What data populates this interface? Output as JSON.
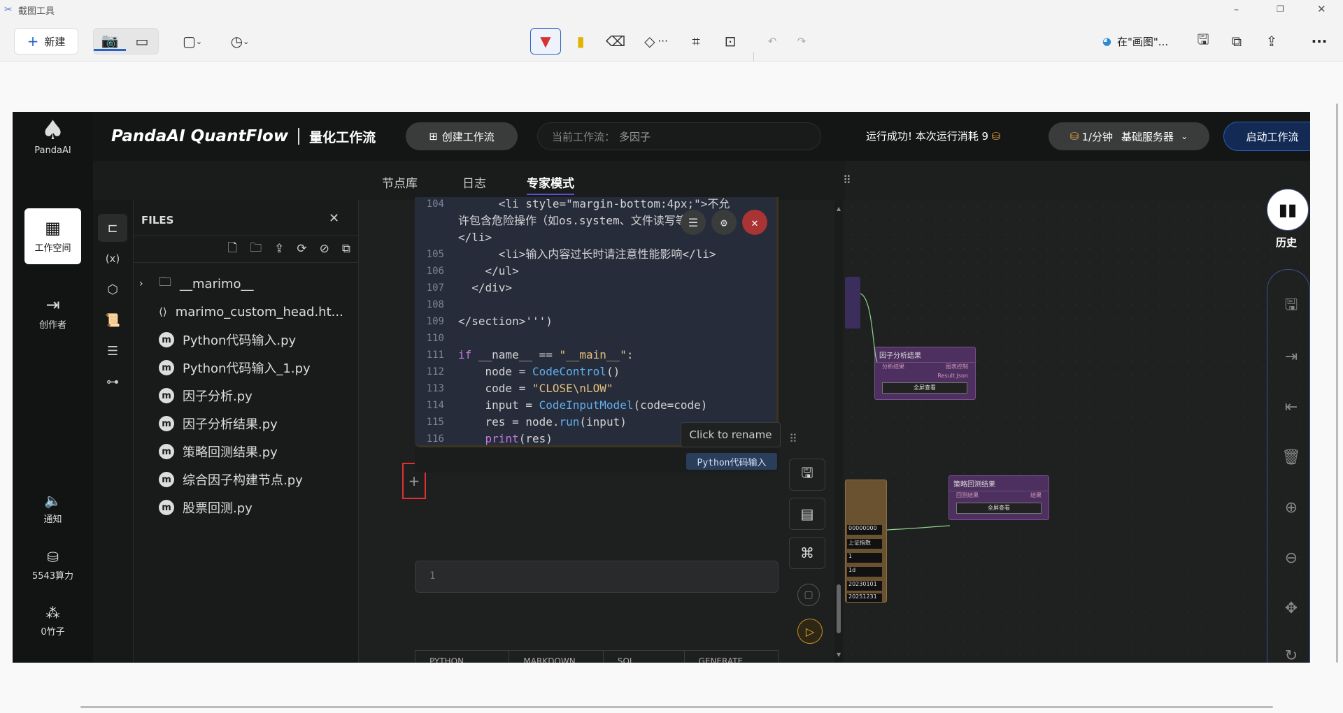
{
  "snip": {
    "title": "截图工具",
    "new_label": "新建",
    "open_in": "在\"画图\"...",
    "window_controls": [
      "–",
      "▢",
      "✕"
    ]
  },
  "app": {
    "brand": "PandaAI",
    "product": "PandaAI QuantFlow",
    "subtitle": "量化工作流",
    "create_btn": "创建工作流",
    "current_label": "当前工作流：",
    "current_value": "多因子",
    "run_status": "运行成功! 本次运行消耗 9",
    "rate": "1/分钟",
    "server": "基础服务器",
    "start_btn": "启动工作流",
    "rail": {
      "workspace": "工作空间",
      "creator": "创作者",
      "notify": "通知",
      "compute": "5543算力",
      "bamboo": "0竹子"
    },
    "tabs": [
      "节点库",
      "日志",
      "专家模式"
    ],
    "files": {
      "header": "FILES",
      "items": [
        {
          "name": "__marimo__",
          "type": "folder"
        },
        {
          "name": "marimo_custom_head.ht...",
          "type": "html"
        },
        {
          "name": "Python代码输入.py",
          "type": "m"
        },
        {
          "name": "Python代码输入_1.py",
          "type": "m"
        },
        {
          "name": "因子分析.py",
          "type": "m"
        },
        {
          "name": "因子分析结果.py",
          "type": "m"
        },
        {
          "name": "策略回测结果.py",
          "type": "m"
        },
        {
          "name": "综合因子构建节点.py",
          "type": "m"
        },
        {
          "name": "股票回测.py",
          "type": "m"
        }
      ]
    },
    "code_lines": [
      {
        "n": "104",
        "html": "<span class='tg'>      &lt;li style=\"margin-bottom:4px;\"&gt;不允</span>"
      },
      {
        "n": "",
        "html": "<span class='tg'>许包含危险操作（如os.system、文件读写等）</span>"
      },
      {
        "n": "",
        "html": "<span class='tg'>&lt;/li&gt;</span>"
      },
      {
        "n": "105",
        "html": "<span class='tg'>      &lt;li&gt;输入内容过长时请注意性能影响&lt;/li&gt;</span>"
      },
      {
        "n": "106",
        "html": "<span class='tg'>    &lt;/ul&gt;</span>"
      },
      {
        "n": "107",
        "html": "<span class='tg'>  &lt;/div&gt;</span>"
      },
      {
        "n": "108",
        "html": ""
      },
      {
        "n": "109",
        "html": "<span class='tg'>&lt;/section&gt;''')</span>"
      },
      {
        "n": "110",
        "html": ""
      },
      {
        "n": "111",
        "html": "<span class='kw'>if</span> __name__ == <span class='st'>\"__main__\"</span>:"
      },
      {
        "n": "112",
        "html": "    node = <span class='fn'>CodeControl</span>()"
      },
      {
        "n": "113",
        "html": "    code = <span class='st'>\"CLOSE\\nLOW\"</span>"
      },
      {
        "n": "114",
        "html": "    input = <span class='fn'>CodeInputModel</span>(code=code)"
      },
      {
        "n": "115",
        "html": "    res = node.<span class='fn'>run</span>(input)"
      },
      {
        "n": "116",
        "html": "    <span class='kw'>print</span>(res)"
      }
    ],
    "rename_tip": "Click to rename",
    "cell_name": "Python代码输入",
    "new_cell_line": "1",
    "cell_types": [
      "PYTHON",
      "MARKDOWN",
      "SQL",
      "GENERATE"
    ],
    "history": "历史",
    "nodes": {
      "factor_result": {
        "title": "因子分析结果",
        "in": "分析结果",
        "out1": "图表控制",
        "out2": "Result Json",
        "btn": "全屏查看"
      },
      "backtest_result": {
        "title": "策略回测结果",
        "in": "回测结果",
        "out": "结果",
        "btn": "全屏查看"
      },
      "params": [
        "00000000",
        "上证指数",
        "1",
        "1d",
        "20230101",
        "20251231"
      ]
    }
  }
}
